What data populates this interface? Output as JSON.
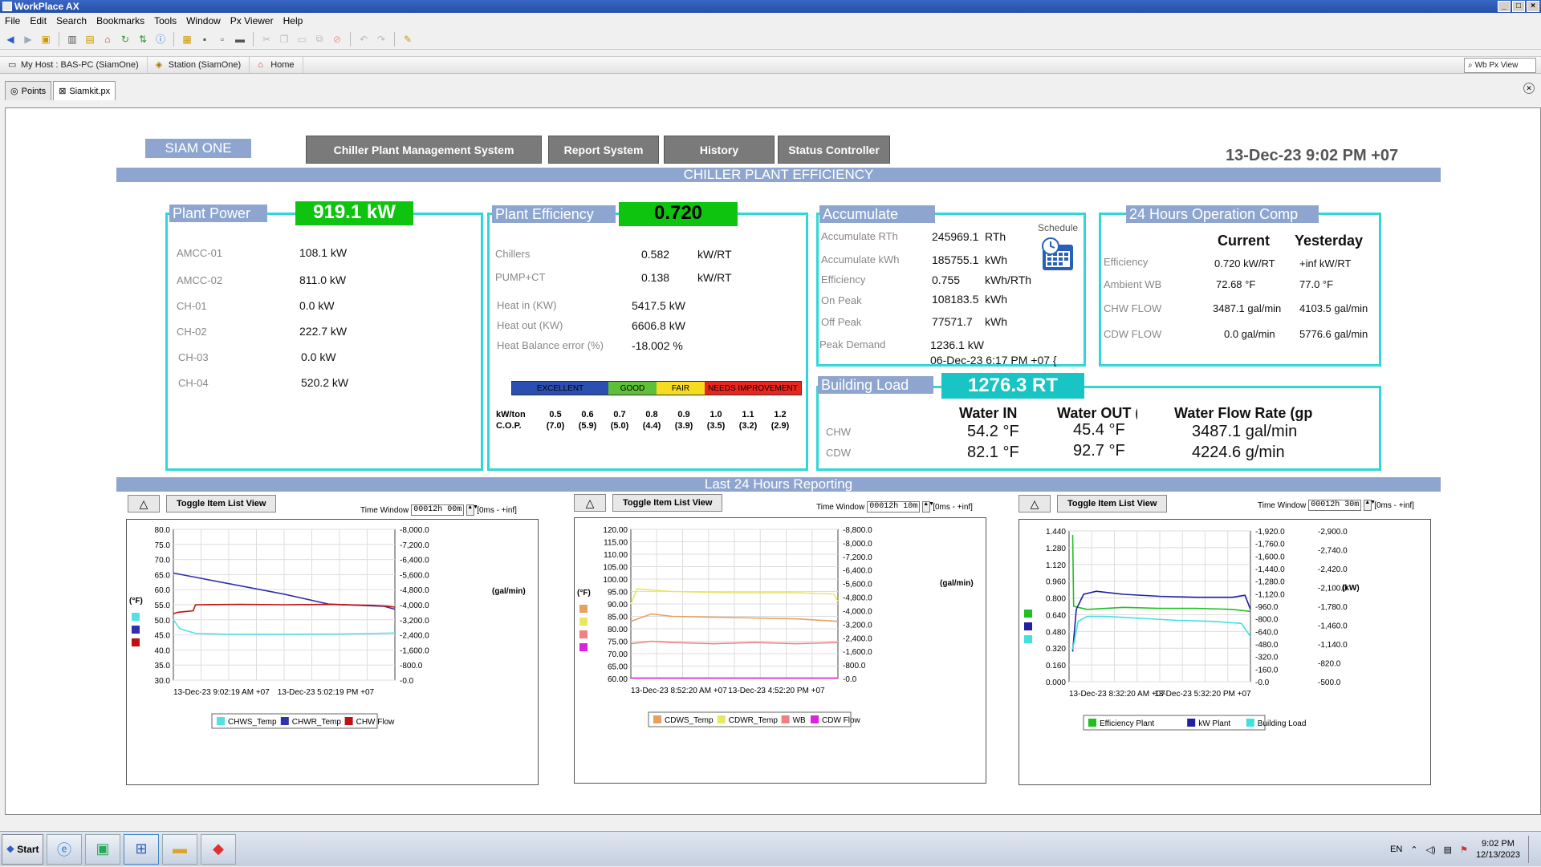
{
  "window": {
    "title": "WorkPlace AX"
  },
  "menu": [
    "File",
    "Edit",
    "Search",
    "Bookmarks",
    "Tools",
    "Window",
    "Px Viewer",
    "Help"
  ],
  "nav": {
    "host": "My Host : BAS-PC (SiamOne)",
    "station": "Station (SiamOne)",
    "home": "Home",
    "view": "Wb Px View"
  },
  "tabs": {
    "points": "Points",
    "siamkit": "Siamkit.px"
  },
  "header": {
    "siam_one": "SIAM ONE",
    "chiller_mgmt": "Chiller Plant Management System",
    "report": "Report System",
    "history": "History",
    "status": "Status Controller",
    "datetime": "13-Dec-23 9:02 PM +07",
    "banner": "CHILLER PLANT EFFICIENCY"
  },
  "plant_power": {
    "title": "Plant Power",
    "value": "919.1 kW",
    "rows": [
      {
        "label": "AMCC-01",
        "value": "108.1 kW"
      },
      {
        "label": "AMCC-02",
        "value": "811.0 kW"
      },
      {
        "label": "CH-01",
        "value": "0.0 kW"
      },
      {
        "label": "CH-02",
        "value": "222.7 kW"
      },
      {
        "label": "CH-03",
        "value": "0.0 kW"
      },
      {
        "label": "CH-04",
        "value": "520.2 kW"
      }
    ]
  },
  "plant_eff": {
    "title": "Plant Efficiency",
    "value": "0.720",
    "rows": [
      {
        "label": "Chillers",
        "value": "0.582",
        "unit": "kW/RT"
      },
      {
        "label": "PUMP+CT",
        "value": "0.138",
        "unit": "kW/RT"
      }
    ],
    "heat_in_label": "Heat in (KW)",
    "heat_in": "5417.5 kW",
    "heat_out_label": "Heat out (KW)",
    "heat_out": "6606.8 kW",
    "balance_label": "Heat Balance error (%)",
    "balance": "-18.002 %",
    "scale": {
      "bands": [
        {
          "label": "EXCELLENT",
          "color": "#2a4fb0"
        },
        {
          "label": "GOOD",
          "color": "#5fbf3a"
        },
        {
          "label": "FAIR",
          "color": "#f5dc1e"
        },
        {
          "label": "NEEDS IMPROVEMENT",
          "color": "#e8261e"
        }
      ],
      "kw_label": "kW/ton",
      "cop_label": "C.O.P.",
      "kw": [
        "0.5",
        "0.6",
        "0.7",
        "0.8",
        "0.9",
        "1.0",
        "1.1",
        "1.2"
      ],
      "cop": [
        "(7.0)",
        "(5.9)",
        "(5.0)",
        "(4.4)",
        "(3.9)",
        "(3.5)",
        "(3.2)",
        "(2.9)"
      ]
    }
  },
  "accumulate": {
    "title": "Accumulate",
    "schedule": "Schedule",
    "rows": [
      {
        "label": "Accumulate RTh",
        "value": "245969.1",
        "unit": "RTh"
      },
      {
        "label": "Accumulate kWh",
        "value": "185755.1",
        "unit": "kWh"
      },
      {
        "label": "Efficiency",
        "value": "0.755",
        "unit": "kWh/RTh"
      },
      {
        "label": "On Peak",
        "value": "108183.5",
        "unit": "kWh"
      },
      {
        "label": "Off Peak",
        "value": "77571.7",
        "unit": "kWh"
      },
      {
        "label": "Peak Demand",
        "value": "1236.1 kW",
        "unit": ""
      }
    ],
    "peak_date": "06-Dec-23 6:17 PM +07 {"
  },
  "ops": {
    "title": "24 Hours Operation Comp",
    "current": "Current",
    "yesterday": "Yesterday",
    "rows": [
      {
        "label": "Efficiency",
        "cur": "0.720  kW/RT",
        "yes": "+inf   kW/RT"
      },
      {
        "label": "Ambient  WB",
        "cur": "72.68 °F",
        "yes": "77.0 °F"
      },
      {
        "label": "CHW FLOW",
        "cur": "3487.1 gal/min",
        "yes": "4103.5 gal/min"
      },
      {
        "label": "CDW FLOW",
        "cur": "0.0 gal/min",
        "yes": "5776.6 gal/min"
      }
    ]
  },
  "building": {
    "title": "Building Load",
    "value": "1276.3  RT",
    "col_in": "Water IN",
    "col_out": "Water OUT (°",
    "col_flow": "Water Flow Rate (gp",
    "chw_label": "CHW",
    "cdw_label": "CDW",
    "chw_in": "54.2 °F",
    "chw_out": "45.4 °F",
    "chw_flow": "3487.1 gal/min",
    "cdw_in": "82.1 °F",
    "cdw_out": "92.7 °F",
    "cdw_flow": "4224.6 g/min"
  },
  "reporting": {
    "banner": "Last 24 Hours Reporting",
    "toggle": "Toggle Item List View",
    "tw_label": "Time Window",
    "range": "[0ms - +inf]"
  },
  "colors": {
    "green": "#0fc40f",
    "teal": "#18c4c4",
    "cyan": "#33d6d6",
    "banner": "#8ea6cf"
  },
  "chart_data": [
    {
      "type": "line",
      "time_window": "00012h  00m",
      "x_ticks": [
        "13-Dec-23 9:02:19 AM +07",
        "13-Dec-23 5:02:19 PM +07"
      ],
      "yleft": [
        30,
        35,
        40,
        45,
        50,
        55,
        60,
        65,
        70,
        75,
        80
      ],
      "yleft_labels": [
        "30.0",
        "35.0",
        "40.0",
        "45.0",
        "50.0",
        "55.0",
        "60.0",
        "65.0",
        "70.0",
        "75.0",
        "80.0"
      ],
      "ylim_left": [
        30,
        80
      ],
      "yright_labels": [
        "0.0",
        "800.0",
        "1,600.0",
        "2,400.0",
        "3,200.0",
        "4,000.0",
        "4,800.0",
        "5,600.0",
        "6,400.0",
        "7,200.0",
        "8,000.0"
      ],
      "left_unit": "(°F)",
      "right_unit": "(gal/min)",
      "series": [
        {
          "name": "CHWS_Temp",
          "color": "#55e0e8",
          "points": [
            [
              0,
              50
            ],
            [
              0.03,
              47
            ],
            [
              0.1,
              45.5
            ],
            [
              0.25,
              45.2
            ],
            [
              0.5,
              45.2
            ],
            [
              0.75,
              45.3
            ],
            [
              1,
              45.6
            ]
          ]
        },
        {
          "name": "CHWR_Temp",
          "color": "#3030b0",
          "points": [
            [
              0,
              65.5
            ],
            [
              0.25,
              62
            ],
            [
              0.5,
              58.5
            ],
            [
              0.7,
              55.2
            ],
            [
              0.95,
              54.5
            ],
            [
              1,
              53.5
            ]
          ]
        },
        {
          "name": "CHW Flow",
          "color": "#c01010",
          "points": [
            [
              0,
              52
            ],
            [
              0.02,
              52.5
            ],
            [
              0.09,
              53
            ],
            [
              0.1,
              55
            ],
            [
              0.3,
              55.1
            ],
            [
              0.5,
              55
            ],
            [
              0.7,
              55.1
            ],
            [
              0.9,
              54.8
            ],
            [
              0.97,
              54.5
            ],
            [
              1,
              54.2
            ]
          ]
        }
      ]
    },
    {
      "type": "line",
      "time_window": "00012h  10m",
      "x_ticks": [
        "13-Dec-23 8:52:20 AM +07",
        "13-Dec-23 4:52:20 PM +07"
      ],
      "yleft": [
        60,
        65,
        70,
        75,
        80,
        85,
        90,
        95,
        100,
        105,
        110,
        115,
        120
      ],
      "yleft_labels": [
        "60.00",
        "65.00",
        "70.00",
        "75.00",
        "80.00",
        "85.00",
        "90.00",
        "95.00",
        "100.00",
        "105.00",
        "110.00",
        "115.00",
        "120.00"
      ],
      "ylim_left": [
        60,
        120
      ],
      "yright_labels": [
        "0.0",
        "800.0",
        "1,600.0",
        "2,400.0",
        "3,200.0",
        "4,000.0",
        "4,800.0",
        "5,600.0",
        "6,400.0",
        "7,200.0",
        "8,000.0",
        "8,800.0"
      ],
      "left_unit": "(°F)",
      "right_unit": "(gal/min)",
      "series": [
        {
          "name": "CDWS_Temp",
          "color": "#e8a060",
          "points": [
            [
              0,
              83
            ],
            [
              0.1,
              86
            ],
            [
              0.2,
              85
            ],
            [
              0.5,
              84.5
            ],
            [
              0.8,
              84
            ],
            [
              1,
              83
            ]
          ]
        },
        {
          "name": "CDWR_Temp",
          "color": "#e8e860",
          "points": [
            [
              0,
              90
            ],
            [
              0.03,
              96
            ],
            [
              0.2,
              95
            ],
            [
              0.5,
              94.5
            ],
            [
              0.8,
              94.5
            ],
            [
              0.98,
              94
            ],
            [
              1,
              91
            ]
          ]
        },
        {
          "name": "WB",
          "color": "#f08080",
          "points": [
            [
              0,
              74
            ],
            [
              0.1,
              75
            ],
            [
              0.2,
              74.5
            ],
            [
              0.4,
              74
            ],
            [
              0.6,
              74.5
            ],
            [
              0.8,
              74
            ],
            [
              1,
              74.5
            ]
          ]
        },
        {
          "name": "CDW Flow",
          "color": "#e020e0",
          "points": [
            [
              0,
              60.2
            ],
            [
              1,
              60.2
            ]
          ]
        }
      ]
    },
    {
      "type": "line",
      "time_window": "00012h  30m",
      "x_ticks": [
        "13-Dec-23 8:32:20 AM +07",
        "13-Dec-23 5:32:20 PM +07"
      ],
      "yleft": [
        0,
        0.16,
        0.32,
        0.48,
        0.64,
        0.8,
        0.96,
        1.12,
        1.28,
        1.44
      ],
      "yleft_labels": [
        "0.000",
        "0.160",
        "0.320",
        "0.480",
        "0.640",
        "0.800",
        "0.960",
        "1.120",
        "1.280",
        "1.440"
      ],
      "ylim_left": [
        0,
        1.5
      ],
      "yright_labels": [
        "0.0",
        "160.0",
        "320.0",
        "480.0",
        "640.0",
        "800.0",
        "960.0",
        "1,120.0",
        "1,280.0",
        "1,440.0",
        "1,600.0",
        "1,760.0",
        "1,920.0"
      ],
      "yright2_labels": [
        "500.0",
        "820.0",
        "1,140.0",
        "1,460.0",
        "1,780.0",
        "2,100.0",
        "2,420.0",
        "2,740.0",
        "2,900.0"
      ],
      "right_unit": "(kW)",
      "series": [
        {
          "name": "Efficiency Plant",
          "color": "#20c020",
          "points": [
            [
              0.02,
              1.46
            ],
            [
              0.025,
              0.75
            ],
            [
              0.1,
              0.72
            ],
            [
              0.3,
              0.74
            ],
            [
              0.5,
              0.73
            ],
            [
              0.7,
              0.73
            ],
            [
              0.9,
              0.72
            ],
            [
              1,
              0.7
            ]
          ]
        },
        {
          "name": "kW Plant",
          "color": "#2020a0",
          "points": [
            [
              0.02,
              0.3
            ],
            [
              0.04,
              0.72
            ],
            [
              0.08,
              0.87
            ],
            [
              0.15,
              0.9
            ],
            [
              0.3,
              0.87
            ],
            [
              0.5,
              0.85
            ],
            [
              0.7,
              0.84
            ],
            [
              0.9,
              0.84
            ],
            [
              0.97,
              0.86
            ],
            [
              1,
              0.72
            ]
          ]
        },
        {
          "name": "Building Load",
          "color": "#40e0e0",
          "points": [
            [
              0.02,
              0.32
            ],
            [
              0.05,
              0.6
            ],
            [
              0.1,
              0.65
            ],
            [
              0.2,
              0.65
            ],
            [
              0.4,
              0.63
            ],
            [
              0.6,
              0.61
            ],
            [
              0.8,
              0.6
            ],
            [
              0.95,
              0.58
            ],
            [
              1,
              0.45
            ]
          ]
        }
      ]
    }
  ],
  "taskbar": {
    "start": "Start",
    "lang": "EN",
    "time": "9:02 PM",
    "date": "12/13/2023"
  }
}
